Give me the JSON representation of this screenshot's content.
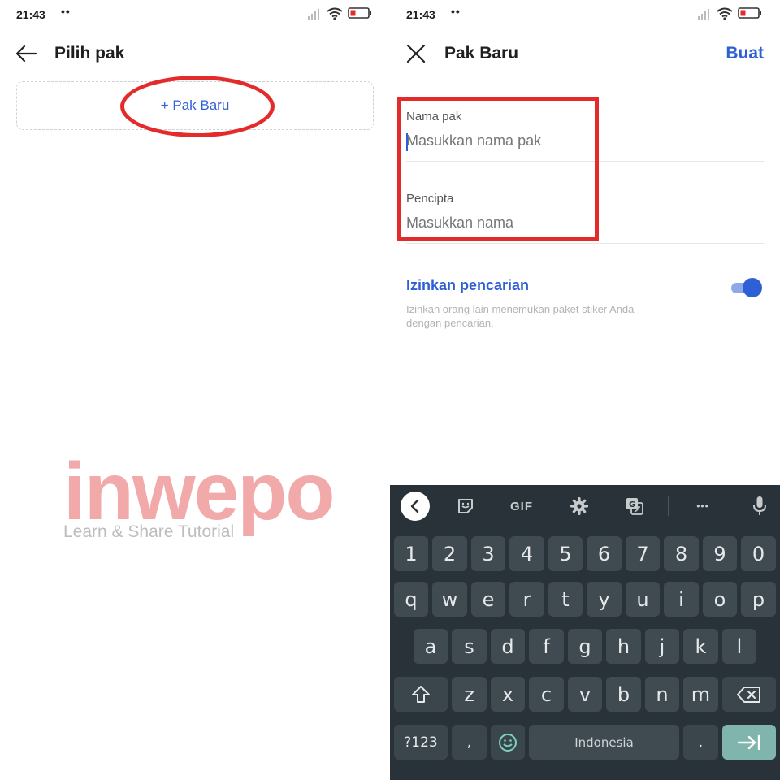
{
  "left": {
    "status": {
      "time": "21:43",
      "dots": "••"
    },
    "title": "Pilih pak",
    "new_pack_label": "+ Pak Baru",
    "watermark": {
      "brand": "inwepo",
      "tagline": "Learn & Share Tutorial"
    }
  },
  "right": {
    "status": {
      "time": "21:43",
      "dots": "••"
    },
    "title": "Pak Baru",
    "action": "Buat",
    "fields": [
      {
        "label": "Nama pak",
        "placeholder": "Masukkan nama pak"
      },
      {
        "label": "Pencipta",
        "placeholder": "Masukkan nama"
      }
    ],
    "search_toggle": {
      "title": "Izinkan pencarian",
      "description": "Izinkan orang lain menemukan paket stiker Anda dengan pencarian.",
      "enabled": true
    },
    "keyboard": {
      "toolbar": {
        "gif": "GIF",
        "more": "•••"
      },
      "row_numbers": [
        "1",
        "2",
        "3",
        "4",
        "5",
        "6",
        "7",
        "8",
        "9",
        "0"
      ],
      "row1": [
        "q",
        "w",
        "e",
        "r",
        "t",
        "y",
        "u",
        "i",
        "o",
        "p"
      ],
      "row2": [
        "a",
        "s",
        "d",
        "f",
        "g",
        "h",
        "j",
        "k",
        "l"
      ],
      "row3": [
        "z",
        "x",
        "c",
        "v",
        "b",
        "n",
        "m"
      ],
      "symbols_key": "?123",
      "comma_key": ",",
      "space_label": "Indonesia",
      "period_key": "."
    }
  },
  "colors": {
    "accent": "#2f5fd4",
    "highlight": "#e32b2b",
    "keyboard_bg": "#283238",
    "key": "#3f4a51",
    "enter_key": "#7fb5ad"
  }
}
